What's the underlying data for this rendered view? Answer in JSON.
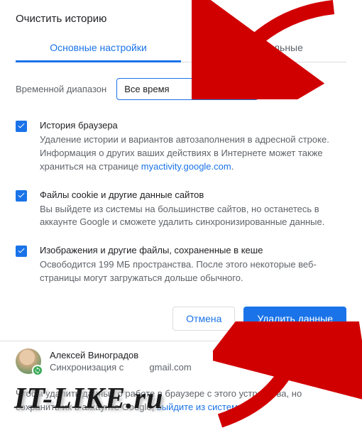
{
  "dialog": {
    "title": "Очистить историю",
    "tabs": {
      "basic": "Основные настройки",
      "advanced": "Дополнительные"
    },
    "range": {
      "label": "Временной диапазон",
      "value": "Все время"
    },
    "options": {
      "history": {
        "title": "История браузера",
        "desc_1": "Удаление истории и вариантов автозаполнения в адресной строке. Информация о других ваших действиях в Интернете может также храниться на странице ",
        "link": "myactivity.google.com",
        "desc_2": "."
      },
      "cookies": {
        "title": "Файлы cookie и другие данные сайтов",
        "desc": "Вы выйдете из системы на большинстве сайтов, но останетесь в аккаунте Google и сможете удалить синхронизированные данные."
      },
      "cache": {
        "title": "Изображения и другие файлы, сохраненные в кеше",
        "desc": "Освободится 199 МБ пространства. После этого некоторые веб-страницы могут загружаться дольше обычного."
      }
    },
    "buttons": {
      "cancel": "Отмена",
      "delete": "Удалить данные"
    }
  },
  "profile": {
    "name": "Алексей Виноградов",
    "sync_prefix": "Синхронизация с ",
    "sync_email": "gmail.com"
  },
  "footer": {
    "text_1": "Чтобы удалить данные о работе в браузере с этого устройства, но сохранить их в аккаунте Google, ",
    "link": "выйдите из системы",
    "text_2": "."
  },
  "watermark": "IT-LIKE.ru"
}
